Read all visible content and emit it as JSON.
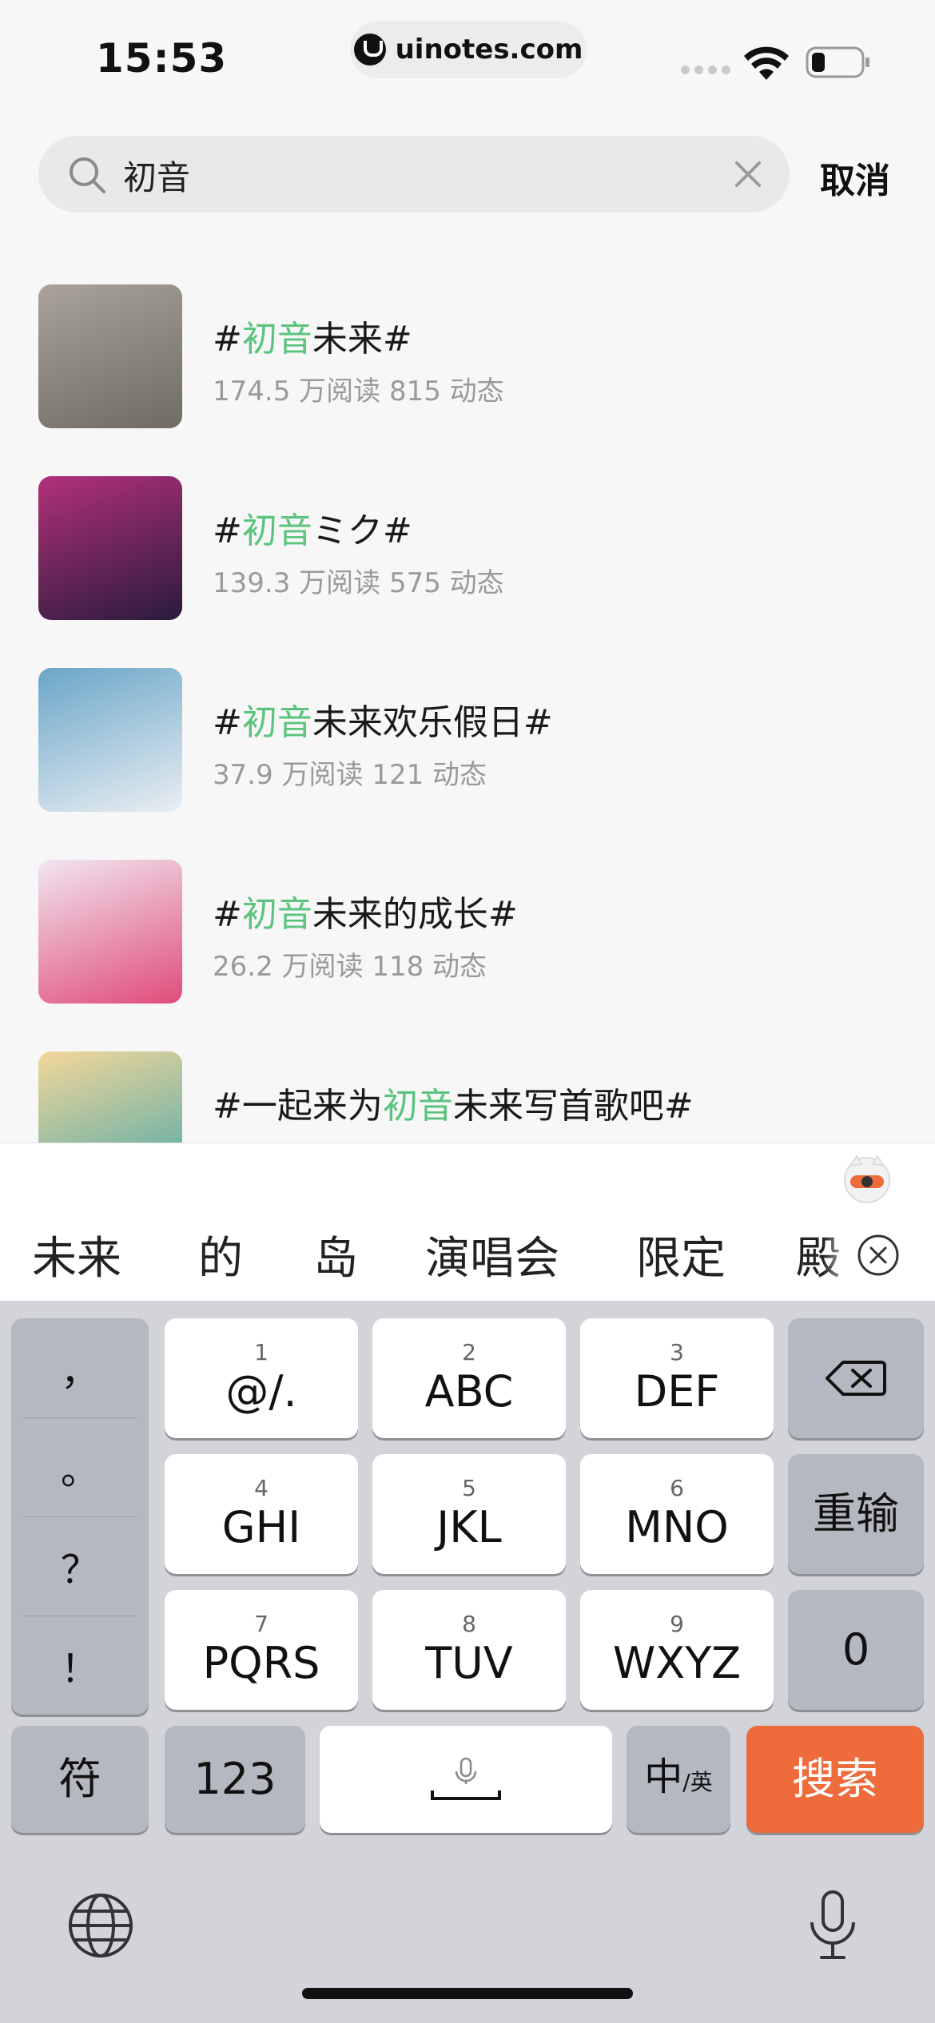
{
  "status_bar": {
    "time": "15:53",
    "url": "uinotes.com"
  },
  "search": {
    "query": "初音",
    "cancel_label": "取消"
  },
  "topics": [
    {
      "prefix": "#",
      "highlight": "初音",
      "suffix": "未来#",
      "meta": "174.5 万阅读 815 动态",
      "thumb_colors": [
        "#a9a39a",
        "#6f6b63"
      ]
    },
    {
      "prefix": "#",
      "highlight": "初音",
      "suffix": "ミク#",
      "meta": "139.3 万阅读 575 动态",
      "thumb_colors": [
        "#b2307a",
        "#2a1b3d"
      ]
    },
    {
      "prefix": "#",
      "highlight": "初音",
      "suffix": "未来欢乐假日#",
      "meta": "37.9 万阅读 121 动态",
      "thumb_colors": [
        "#6aa6c8",
        "#e9eef2"
      ]
    },
    {
      "prefix": "#",
      "highlight": "初音",
      "suffix": "未来的成长#",
      "meta": "26.2 万阅读 118 动态",
      "thumb_colors": [
        "#f1e6f0",
        "#e04c7a"
      ]
    },
    {
      "prefix": "#一起来为",
      "highlight": "初音",
      "suffix": "未来写首歌吧#",
      "meta": "",
      "thumb_colors": [
        "#f3d79a",
        "#4aa7a8"
      ]
    }
  ],
  "candidates": [
    "未来",
    "的",
    "岛",
    "演唱会",
    "限定",
    "殿"
  ],
  "keyboard": {
    "punctuation": [
      "，",
      "。",
      "？",
      "！"
    ],
    "keys": [
      {
        "num": "1",
        "label": "@/."
      },
      {
        "num": "2",
        "label": "ABC"
      },
      {
        "num": "3",
        "label": "DEF"
      },
      {
        "num": "4",
        "label": "GHI"
      },
      {
        "num": "5",
        "label": "JKL"
      },
      {
        "num": "6",
        "label": "MNO"
      },
      {
        "num": "7",
        "label": "PQRS"
      },
      {
        "num": "8",
        "label": "TUV"
      },
      {
        "num": "9",
        "label": "WXYZ"
      }
    ],
    "reinput_label": "重输",
    "zero_label": "0",
    "symbol_label": "符",
    "numeric_label": "123",
    "lang_main": "中",
    "lang_sub": "/英",
    "search_label": "搜索",
    "search_color": "#ee6b3b"
  }
}
